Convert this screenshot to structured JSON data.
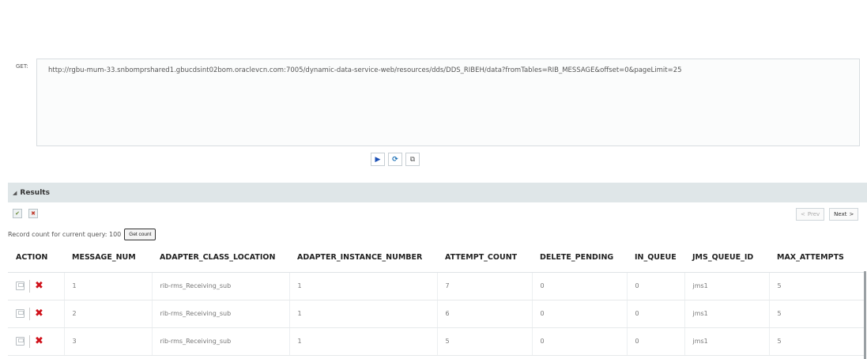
{
  "query": {
    "method_label": "GET:",
    "url": "http://rgbu-mum-33.snbomprshared1.gbucdsint02bom.oraclevcn.com:7005/dynamic-data-service-web/resources/dds/DDS_RIBEH/data?fromTables=RIB_MESSAGE&offset=0&pageLimit=25"
  },
  "exec_toolbar": {
    "icons": [
      "play-icon",
      "refresh-icon",
      "copy-icon"
    ]
  },
  "results": {
    "title": "Results",
    "record_count_label": "Record count for current query: 100",
    "get_count_label": "Get count",
    "prev_label": "Prev",
    "next_label": "Next"
  },
  "table": {
    "columns": [
      "ACTION",
      "MESSAGE_NUM",
      "ADAPTER_CLASS_LOCATION",
      "ADAPTER_INSTANCE_NUMBER",
      "ATTEMPT_COUNT",
      "DELETE_PENDING",
      "IN_QUEUE",
      "JMS_QUEUE_ID",
      "MAX_ATTEMPTS"
    ],
    "rows": [
      [
        "1",
        "rib-rms_Receiving_sub",
        "1",
        "7",
        "0",
        "0",
        "jms1",
        "5"
      ],
      [
        "2",
        "rib-rms_Receiving_sub",
        "1",
        "6",
        "0",
        "0",
        "jms1",
        "5"
      ],
      [
        "3",
        "rib-rms_Receiving_sub",
        "1",
        "5",
        "0",
        "0",
        "jms1",
        "5"
      ]
    ]
  },
  "colors": {
    "delete": "#d0121b",
    "results_bar": "#dfe6e8",
    "play": "#1a4fb5"
  }
}
